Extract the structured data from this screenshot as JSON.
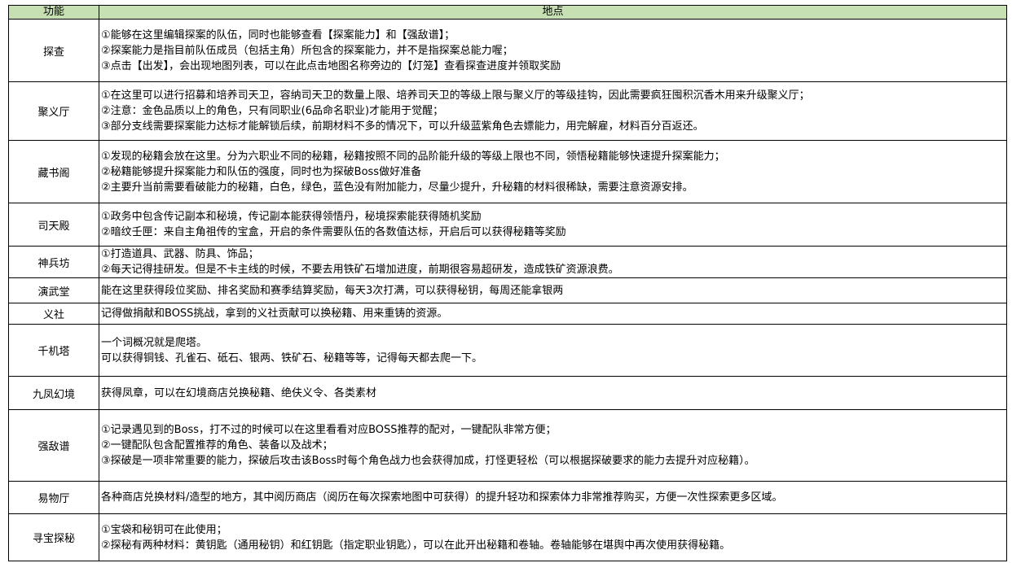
{
  "header": {
    "function_col": "功能",
    "location_col": "地点"
  },
  "rows": [
    {
      "name": "探查",
      "lines": [
        "①能够在这里编辑探案的队伍，同时也能够查看【探案能力】和【强敌谱】；",
        "②探案能力是指目前队伍成员（包括主角）所包含的探案能力，并不是指探案总能力喔；",
        "③点击【出发】，会出现地图列表，可以在此点击地图名称旁边的【灯笼】查看探查进度并领取奖励"
      ]
    },
    {
      "name": "聚义厅",
      "lines": [
        "①在这里可以进行招募和培养司天卫，容纳司天卫的数量上限、培养司天卫的等级上限与聚义厅的等级挂钩，因此需要疯狂囤积沉香木用来升级聚义厅；",
        "②注意：金色品质以上的角色，只有同职业(6品命名职业)才能用于觉醒；",
        "③部分支线需要探案能力达标才能解锁后续，前期材料不多的情况下，可以升级蓝紫角色去嫖能力，用完解雇，材料百分百返还。"
      ]
    },
    {
      "name": "藏书阁",
      "lines": [
        "①发现的秘籍会放在这里。分为六职业不同的秘籍，秘籍按照不同的品阶能升级的等级上限也不同，领悟秘籍能够快速提升探案能力；",
        "②秘籍能够提升探案能力和队伍的强度，同时也为探破Boss做好准备",
        "②主要升当前需要看破能力的秘籍，白色，绿色，蓝色没有附加能力，尽量少提升，升秘籍的材料很稀缺，需要注意资源安排。"
      ]
    },
    {
      "name": "司天殿",
      "lines": [
        "①政务中包含传记副本和秘境，传记副本能获得领悟丹，秘境探索能获得随机奖励",
        "②暗纹壬匣：来自主角祖传的宝盒，开启的条件需要队伍的各数值达标，开启后可以获得秘籍等奖励"
      ]
    },
    {
      "name": "神兵坊",
      "lines": [
        "①打造道具、武器、防具、饰品；",
        "②每天记得挂研发。但是不卡主线的时候，不要去用铁矿石增加进度，前期很容易超研发，造成铁矿资源浪费。"
      ]
    },
    {
      "name": "演武堂",
      "lines": [
        "能在这里获得段位奖励、排名奖励和赛季结算奖励，每天3次打满，可以获得秘钥，每周还能拿银两"
      ]
    },
    {
      "name": "义社",
      "lines": [
        "记得做捐献和BOSS挑战，拿到的义社贡献可以换秘籍、用来重铸的资源。"
      ]
    },
    {
      "name": "千机塔",
      "lines": [
        "一个词概况就是爬塔。",
        "可以获得铜钱、孔雀石、砥石、银两、铁矿石、秘籍等等，记得每天都去爬一下。"
      ]
    },
    {
      "name": "九凤幻境",
      "lines": [
        "获得凤章，可以在幻境商店兑换秘籍、绝伕义令、各类素材"
      ]
    },
    {
      "name": "强敌谱",
      "lines": [
        "①记录遇见到的Boss，打不过的时候可以在这里看看对应BOSS推荐的配对，一键配队非常方便；",
        "②一键配队包含配置推荐的角色、装备以及战术；",
        "③探破是一项非常重要的能力，探破后攻击该Boss时每个角色战力也会获得加成，打怪更轻松（可以根据探破要求的能力去提升对应秘籍）。"
      ]
    },
    {
      "name": "易物厅",
      "lines": [
        "各种商店兑换材料/造型的地方，其中阅历商店（阅历在每次探索地图中可获得）的提升轻功和探索体力非常推荐购买，方便一次性探索更多区域。"
      ]
    },
    {
      "name": "寻宝探秘",
      "lines": [
        "①宝袋和秘钥可在此使用；",
        "②探秘有两种材料：黄钥匙（通用秘钥）和红钥匙（指定职业钥匙），可以在此开出秘籍和卷轴。卷轴能够在堪舆中再次使用获得秘籍。"
      ]
    }
  ]
}
